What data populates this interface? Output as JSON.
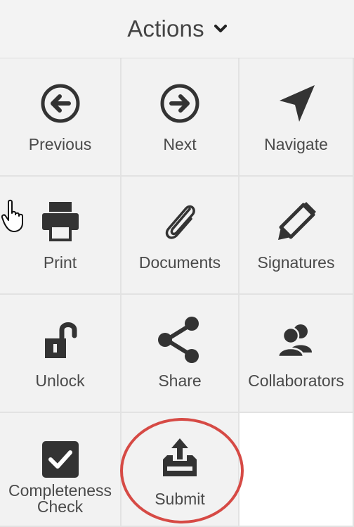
{
  "header": {
    "title": "Actions",
    "chevron_icon": "chevron-down-icon"
  },
  "tiles": [
    {
      "label": "Previous",
      "icon": "arrow-left-circle-icon"
    },
    {
      "label": "Next",
      "icon": "arrow-right-circle-icon"
    },
    {
      "label": "Navigate",
      "icon": "navigation-arrow-icon"
    },
    {
      "label": "Print",
      "icon": "printer-icon"
    },
    {
      "label": "Documents",
      "icon": "paperclip-icon"
    },
    {
      "label": "Signatures",
      "icon": "pencil-icon"
    },
    {
      "label": "Unlock",
      "icon": "unlock-icon"
    },
    {
      "label": "Share",
      "icon": "share-icon"
    },
    {
      "label": "Collaborators",
      "icon": "users-icon"
    },
    {
      "label": "Completeness Check",
      "icon": "checkbox-icon"
    },
    {
      "label": "Submit",
      "icon": "upload-tray-icon"
    }
  ],
  "colors": {
    "icon": "#333333",
    "label": "#4a4a4a",
    "highlight": "#d64a45",
    "tile_bg": "#f2f2f2"
  }
}
